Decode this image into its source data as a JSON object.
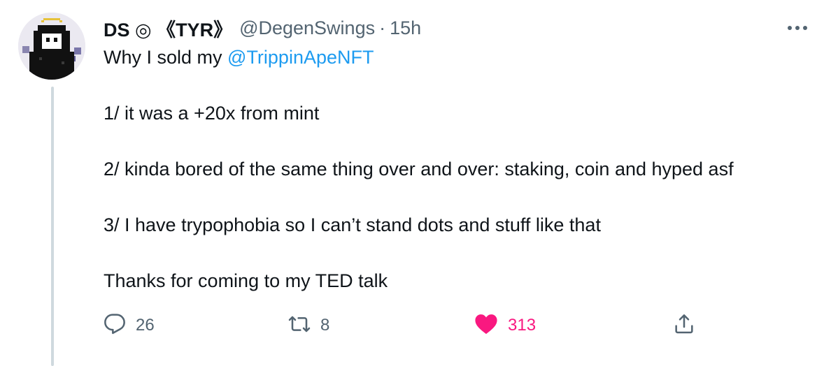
{
  "tweet": {
    "display_name": "DS ◎ 《TYR》",
    "handle": "@DegenSwings",
    "separator": "·",
    "timestamp": "15h",
    "body": {
      "line1_prefix": "Why I sold my ",
      "line1_mention": "@TrippinApeNFT",
      "line2": "1/ it was a +20x from mint",
      "line3": "2/ kinda bored of the same thing over and over: staking, coin and hyped asf",
      "line4": "3/ I have trypophobia so I can’t stand dots and stuff like that",
      "line5": "Thanks for coming to my TED talk"
    },
    "actions": {
      "reply_count": "26",
      "retweet_count": "8",
      "like_count": "313",
      "liked": true
    },
    "icons": {
      "more": "more-horizontal-icon",
      "reply": "reply-icon",
      "retweet": "retweet-icon",
      "like": "heart-icon",
      "share": "share-icon"
    },
    "colors": {
      "text": "#0f1419",
      "secondary": "#536471",
      "link": "#1d9bf0",
      "like": "#f91880",
      "thread_line": "#cfd9de"
    }
  }
}
